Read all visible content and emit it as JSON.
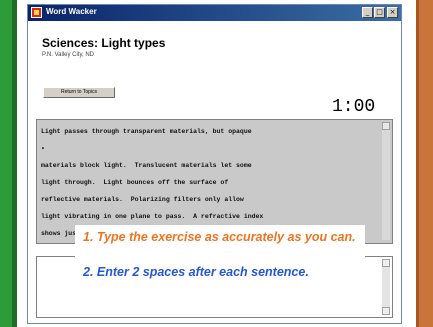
{
  "window": {
    "title": "Word Wacker"
  },
  "header": {
    "title": "Sciences: Light types",
    "location": "P.N. Valley City, ND"
  },
  "buttons": {
    "return": "Return to Topics"
  },
  "timer": "1:00",
  "exercise_lines": [
    "Light passes through transparent materials, but opaque",
    "materials block light.  Translucent materials let some",
    "light through.  Light bounces off the surface of",
    "reflective materials.  Polarizing filters only allow",
    "light vibrating in one plane to pass.  A refractive index",
    "shows just how much a material reflects light."
  ],
  "cursor_mark": "•",
  "instructions": [
    "1.  Type the exercise as accurately as you can.",
    "2.  Enter 2 spaces after each sentence."
  ],
  "colors": {
    "instruction_1": "#f07320",
    "instruction_2": "#2456d8"
  }
}
